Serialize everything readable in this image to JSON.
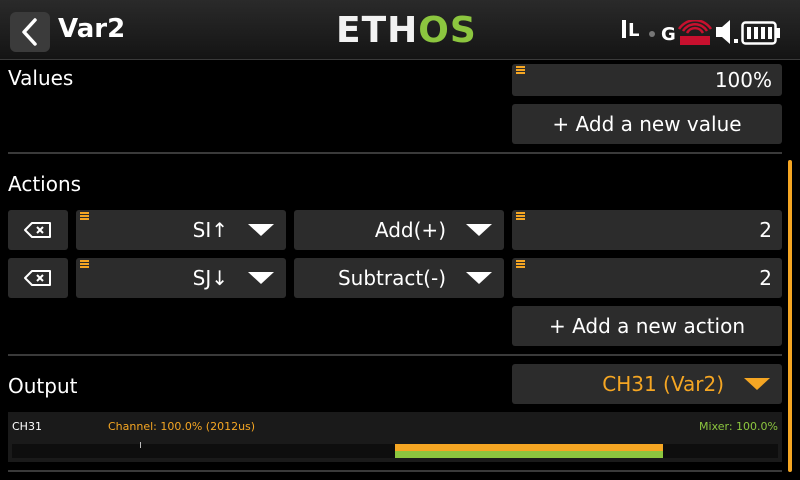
{
  "header": {
    "title": "Var2",
    "logo_part1": "ETH",
    "logo_part2": "OS",
    "status_l": "L",
    "status_g": "G",
    "back_icon": "chevron-left-icon"
  },
  "values": {
    "label": "Values",
    "value": "100%",
    "add_button": "+ Add a new value"
  },
  "actions": {
    "label": "Actions",
    "rows": [
      {
        "source": "SI↑",
        "operation": "Add(+)",
        "value": "2"
      },
      {
        "source": "SJ↓",
        "operation": "Subtract(-)",
        "value": "2"
      }
    ],
    "add_button": "+ Add a new action"
  },
  "output": {
    "label": "Output",
    "selected": "CH31 (Var2)",
    "channel_name": "CH31",
    "channel_text": "Channel: 100.0% (2012us)",
    "mixer_text": "Mixer: 100.0%",
    "channel_percent": 100,
    "mixer_percent": 100
  },
  "colors": {
    "accent": "#f5a623",
    "brand_green": "#8cc63f",
    "field_bg": "#2c2c2c"
  }
}
